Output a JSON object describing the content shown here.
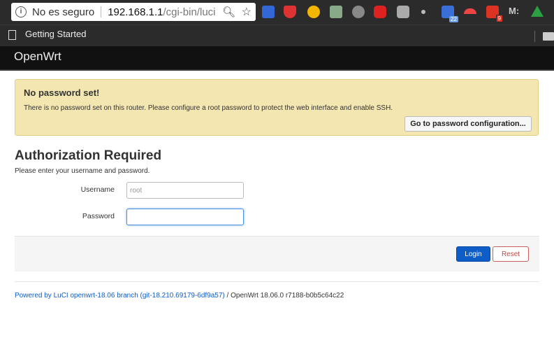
{
  "browser": {
    "security_label": "No es seguro",
    "url_host": "192.168.1.1",
    "url_path": "/cgi-bin/luci",
    "bookmark_label": "Getting Started",
    "extension_badges": {
      "calendar": "22",
      "mail": "9"
    },
    "extension_colors": [
      "#3367d6",
      "#d33",
      "#f2b600",
      "#8a8",
      "#888",
      "#d22",
      "#aaa",
      "#bbb",
      "#3a6fd8",
      "#e44",
      "#d32",
      "#ccc",
      "#2c9f45"
    ]
  },
  "header": {
    "brand": "OpenWrt"
  },
  "alert": {
    "title": "No password set!",
    "message": "There is no password set on this router. Please configure a root password to protect the web interface and enable SSH.",
    "button_label": "Go to password configuration..."
  },
  "auth": {
    "title": "Authorization Required",
    "subtitle": "Please enter your username and password.",
    "username_label": "Username",
    "username_placeholder": "root",
    "password_label": "Password",
    "password_value": ""
  },
  "actions": {
    "login_label": "Login",
    "reset_label": "Reset"
  },
  "footer": {
    "link_text": "Powered by LuCI openwrt-18.06 branch (git-18.210.69179-6df9a57)",
    "version_text": " / OpenWrt 18.06.0 r7188-b0b5c64c22"
  },
  "colors": {
    "accent": "#0f5dc7",
    "alert_bg": "#f3e6b0",
    "danger": "#b94a48"
  }
}
